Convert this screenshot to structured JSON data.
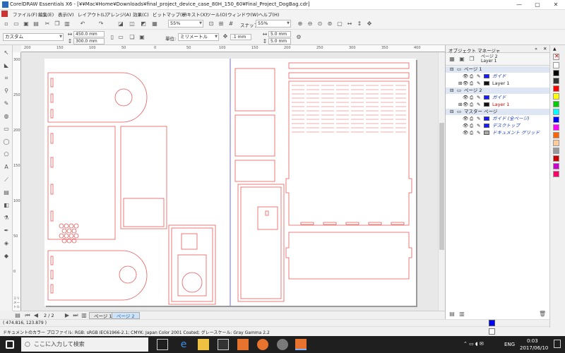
{
  "window": {
    "title": "CorelDRAW Essentials X6 - [¥¥Mac¥Home¥Downloads¥final_project_device_case_80H_150_60¥Final_Project_DogBag.cdr]",
    "minimize": "—",
    "maximize": "▢",
    "close": "✕"
  },
  "menu": [
    "ファイル(F)",
    "編集(E)",
    "表示(V)",
    "レイアウト(L)",
    "アレンジ(A)",
    "効果(C)",
    "ビットマップ(B)",
    "テキスト(X)",
    "ツール(O)",
    "ウィンドウ(W)",
    "ヘルプ(H)"
  ],
  "toolbar1": {
    "zoom1": "55%",
    "snap_label": "スナップ(P)",
    "zoom2": "55%"
  },
  "toolbar2": {
    "preset": "カスタム",
    "width": "450.0 mm",
    "height": "300.0 mm",
    "units_label": "単位:",
    "units": "ミリメートル",
    "nudge": ".1 mm",
    "dup_x": "5.0 mm",
    "dup_y": "5.0 mm"
  },
  "rulers": {
    "top": [
      "200",
      "150",
      "100",
      "50",
      "0",
      "50",
      "100",
      "150",
      "200",
      "250",
      "300",
      "350",
      "400"
    ],
    "left": [
      "300",
      "250",
      "200",
      "150",
      "100",
      "50",
      "0"
    ],
    "units": "ミリメートル"
  },
  "pagebar": {
    "counter": "2 / 2",
    "tabs": [
      "ページ 1",
      "ページ 2"
    ]
  },
  "status": {
    "coords": "( 474.816, 123.879 )",
    "color_profile": "ドキュメントのカラー プロファイル: RGB: sRGB IEC61966-2.1; CMYK: Japan Color 2001 Coated; グレースケール: Gray Gamma 2.2"
  },
  "docker": {
    "title": "オブジェクト マネージャ",
    "current_page": "ページ 2",
    "current_layer": "Layer 1",
    "tree": [
      {
        "label": "ページ 1",
        "type": "page"
      },
      {
        "label": "ガイド",
        "type": "layer",
        "color": "#1a1aff",
        "italic": true
      },
      {
        "label": "Layer 1",
        "type": "layer",
        "color": "#111111",
        "italic": false
      },
      {
        "label": "ページ 2",
        "type": "page"
      },
      {
        "label": "ガイド",
        "type": "layer",
        "color": "#1a1aff",
        "italic": true
      },
      {
        "label": "Layer 1",
        "type": "layer",
        "color": "#111111",
        "italic": false,
        "red": true
      },
      {
        "label": "マスター ページ",
        "type": "page"
      },
      {
        "label": "ガイド (全ページ)",
        "type": "layer",
        "color": "#1a1aff",
        "italic": true
      },
      {
        "label": "デスクトップ",
        "type": "layer",
        "color": "#1a1aff",
        "italic": true
      },
      {
        "label": "ドキュメント グリッド",
        "type": "layer",
        "color": "#aaaaaa",
        "italic": true
      }
    ]
  },
  "palette": [
    "#ffffff",
    "#000000",
    "#333333",
    "#ff0000",
    "#ffff00",
    "#00cc00",
    "#00ffff",
    "#0000ff",
    "#ff00ff",
    "#ff6600",
    "#ffcc99",
    "#999999",
    "#cc0000",
    "#cc00cc",
    "#ff0066"
  ],
  "taskbar": {
    "search_placeholder": "ここに入力して検索",
    "lang": "ENG",
    "time": "0:03",
    "date": "2017/06/10"
  },
  "colors": {
    "cut_line": "#e85a5a",
    "guide": "#3333cc"
  }
}
